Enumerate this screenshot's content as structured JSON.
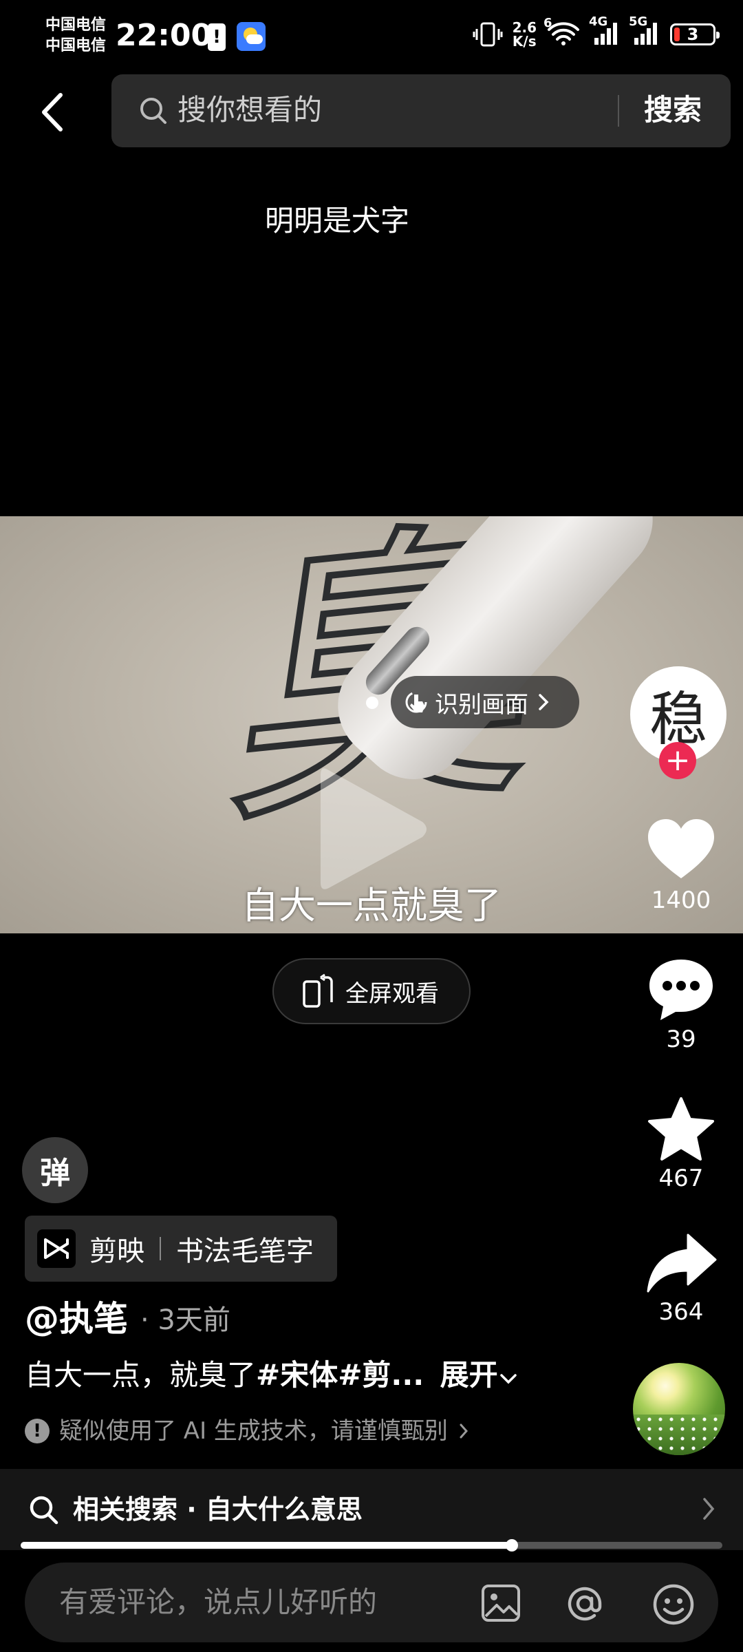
{
  "status_bar": {
    "carrier1": "中国电信",
    "carrier2": "中国电信",
    "time": "22:00",
    "net_speed_top": "2.6",
    "net_speed_bottom": "K/s",
    "wifi_label": "6",
    "sig1_label": "4G",
    "sig2_label": "5G",
    "battery": "3"
  },
  "search": {
    "placeholder": "搜你想看的",
    "button": "搜索"
  },
  "video": {
    "title": "明明是犬字",
    "char": "臭",
    "subtitle": "自大一点就臭了",
    "recognize_label": "识别画面",
    "fullscreen_label": "全屏观看",
    "progress": 0.7
  },
  "creator": {
    "avatar_char": "稳",
    "follow": "+"
  },
  "actions": {
    "likes": "1400",
    "comments": "39",
    "favorites": "467",
    "shares": "364"
  },
  "info": {
    "danmu": "弹",
    "capcut_app": "剪映",
    "capcut_template": "书法毛笔字",
    "author": "@执笔",
    "time_ago": "· 3天前",
    "desc_text": "自大一点，就臭了",
    "desc_tags": "#宋体#剪...",
    "expand": "展开",
    "ai_notice": "疑似使用了 AI 生成技术，请谨慎甄别"
  },
  "related": {
    "label": "相关搜索 · 自大什么意思"
  },
  "comment": {
    "placeholder": "有爱评论，说点儿好听的"
  },
  "colors": {
    "follow_red": "#ec2a53",
    "background": "#000000"
  }
}
